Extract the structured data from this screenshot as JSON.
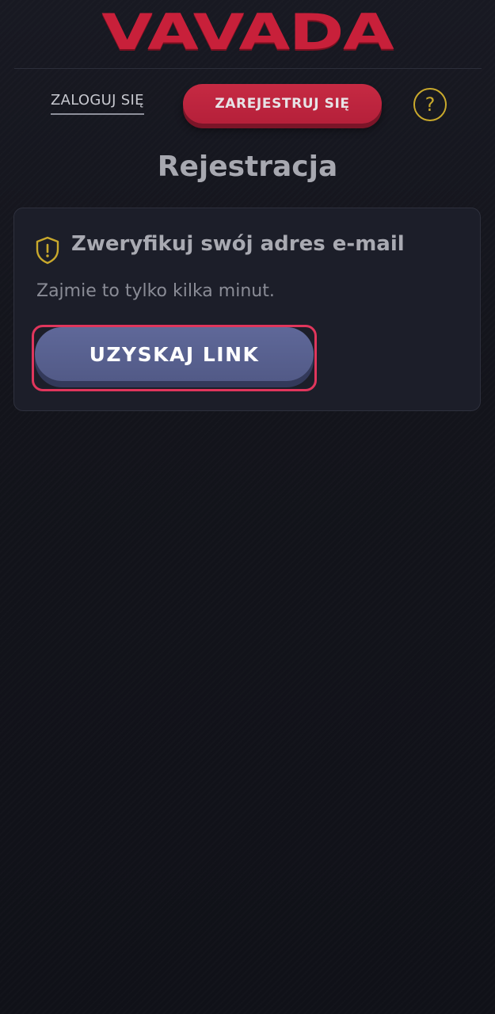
{
  "header": {
    "logo_text": "VAVADA",
    "login_label": "ZALOGUJ SIĘ",
    "register_label": "ZAREJESTRUJ SIĘ",
    "help_icon": "help-circle-icon",
    "help_glyph": "?"
  },
  "main": {
    "title": "Rejestracja",
    "card": {
      "icon": "shield-alert-icon",
      "title": "Zweryfikuj swój adres e-mail",
      "subtitle": "Zajmie to tylko kilka minut.",
      "button_label": "UZYSKAJ LINK"
    }
  },
  "colors": {
    "brand": "#c8203a",
    "accent_gold": "#c9a92c",
    "button": "#5a6290",
    "focus": "#e0365c",
    "background": "#13141c"
  }
}
